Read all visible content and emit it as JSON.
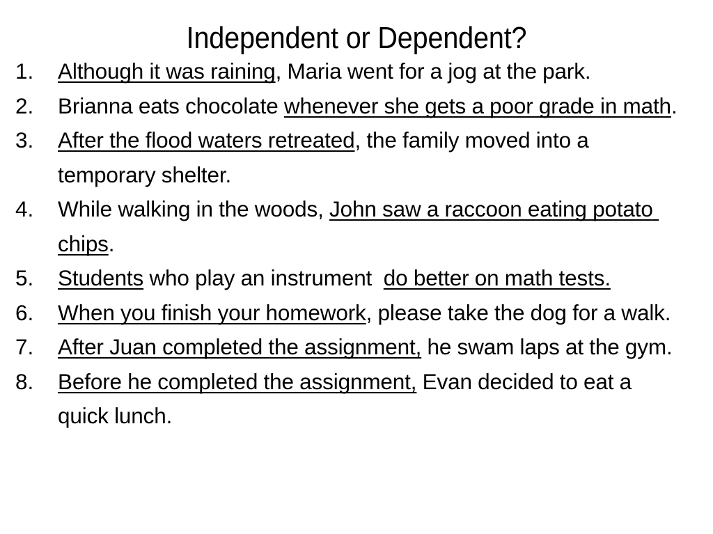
{
  "slide": {
    "title": "Independent or Dependent?",
    "background_color": "#ffffff",
    "text_color": "#000000",
    "items": [
      {
        "number": "1.",
        "full_text": "Although it was raining, Maria went for a jog at the park.",
        "segments": [
          {
            "text": "Although it was raining",
            "underlined": true
          },
          {
            "text": ", Maria went for a jog at the park.",
            "underlined": false
          }
        ]
      },
      {
        "number": "2.",
        "full_text": "Brianna eats chocolate whenever she gets a poor grade in math.",
        "segments": [
          {
            "text": "Brianna eats chocolate ",
            "underlined": false
          },
          {
            "text": "whenever she gets a poor grade in math",
            "underlined": true
          },
          {
            "text": ".",
            "underlined": false
          }
        ]
      },
      {
        "number": "3.",
        "full_text": "After the flood waters retreated, the family moved into a temporary shelter.",
        "segments": [
          {
            "text": "After the flood waters retreated",
            "underlined": true
          },
          {
            "text": ", the family moved into a temporary shelter.",
            "underlined": false
          }
        ]
      },
      {
        "number": "4.",
        "full_text": "While walking in the woods, John saw a raccoon eating potato chips.",
        "segments": [
          {
            "text": "While walking in the woods, ",
            "underlined": false
          },
          {
            "text": "John saw a raccoon eating potato chips",
            "underlined": true
          },
          {
            "text": ".",
            "underlined": false
          }
        ]
      },
      {
        "number": "5.",
        "full_text": "Students who play an instrument  do better on math tests.",
        "segments": [
          {
            "text": "Students",
            "underlined": true
          },
          {
            "text": " who play an instrument  ",
            "underlined": false
          },
          {
            "text": "do better on math tests.",
            "underlined": true
          }
        ]
      },
      {
        "number": "6.",
        "full_text": "When you finish your homework, please take the dog for a walk.",
        "segments": [
          {
            "text": "When you finish your homework",
            "underlined": true
          },
          {
            "text": ", please take the dog for a walk.",
            "underlined": false
          }
        ]
      },
      {
        "number": "7.",
        "full_text": "After Juan completed the assignment, he swam laps at the gym.",
        "segments": [
          {
            "text": "After Juan completed the assignment,",
            "underlined": true
          },
          {
            "text": " he swam laps at the gym.",
            "underlined": false
          }
        ]
      },
      {
        "number": "8.",
        "full_text": "Before he completed the assignment, Evan decided to eat a quick lunch.",
        "segments": [
          {
            "text": "Before he completed the assignment,",
            "underlined": true
          },
          {
            "text": " Evan decided to eat a quick lunch.",
            "underlined": false
          }
        ]
      }
    ]
  }
}
